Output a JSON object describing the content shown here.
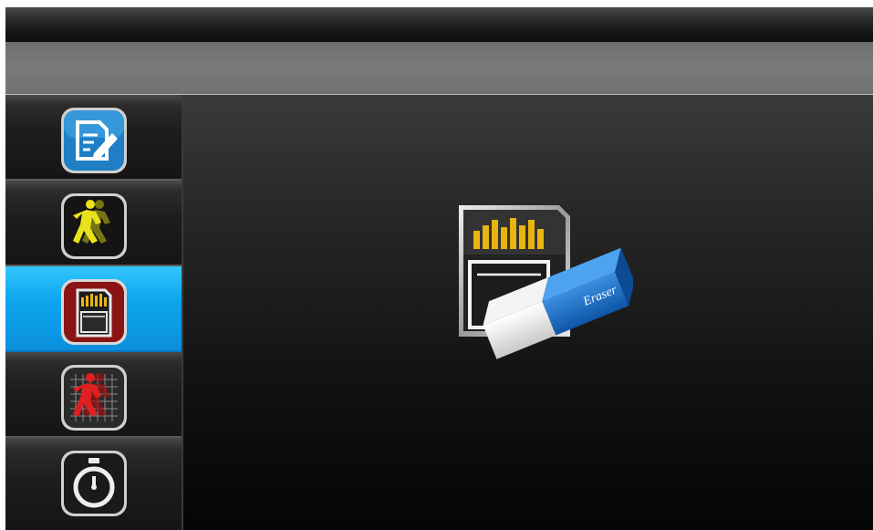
{
  "sidebar": {
    "items": [
      {
        "icon": "edit-document-icon",
        "active": false
      },
      {
        "icon": "motion-detection-icon",
        "active": false
      },
      {
        "icon": "format-sd-card-icon",
        "active": true
      },
      {
        "icon": "motion-zone-grid-icon",
        "active": false
      },
      {
        "icon": "timer-icon",
        "active": false
      }
    ]
  },
  "main": {
    "icon": "format-sd-card-eraser-icon",
    "eraser_label": "Eraser"
  },
  "colors": {
    "active_item": "#0ea6ee",
    "icon_gold": "#e8b510",
    "motion_yellow": "#e9e21a",
    "motion_red": "#e02020",
    "eraser_blue": "#1d6fc8"
  }
}
